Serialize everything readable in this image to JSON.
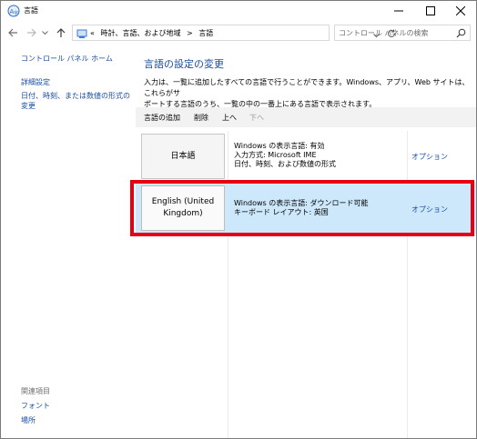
{
  "window": {
    "title": "言語",
    "controls": {
      "minimize": "minimize",
      "maximize": "maximize",
      "close": "close"
    }
  },
  "address": {
    "overflow": "«",
    "breadcrumb": [
      "時計、言語、および地域",
      "言語"
    ],
    "separator": ">"
  },
  "search": {
    "placeholder": "コントロール パネルの検索"
  },
  "sidebar": {
    "home": "コントロール パネル ホーム",
    "advanced": "詳細設定",
    "datetime_formats": [
      "日付、時刻、または数値の形式の",
      "変更"
    ],
    "related_heading": "関連項目",
    "related": [
      "フォント",
      "場所"
    ]
  },
  "main": {
    "title": "言語の設定の変更",
    "description": [
      "入力は、一覧に追加したすべての言語で行うことができます。Windows、アプリ、Web サイトは、これらがサ",
      "ポートする言語のうち、一覧の中の一番上にある言語で表示されます。"
    ],
    "toolbar": {
      "add": "言語の追加",
      "remove": "削除",
      "up": "上へ",
      "down": "下へ"
    }
  },
  "languages": [
    {
      "name": [
        "日本語"
      ],
      "info": [
        "Windows の表示言語: 有効",
        "入力方式: Microsoft IME",
        "日付、時刻、および数値の形式"
      ],
      "options": "オプション",
      "selected": false
    },
    {
      "name": [
        "English (United",
        "Kingdom)"
      ],
      "info": [
        "Windows の表示言語: ダウンロード可能",
        "キーボード レイアウト: 英国"
      ],
      "options": "オプション",
      "selected": true
    }
  ],
  "colors": {
    "link": "#1a4ea1",
    "selection": "#cde8fb",
    "highlight_frame": "#e60012"
  }
}
